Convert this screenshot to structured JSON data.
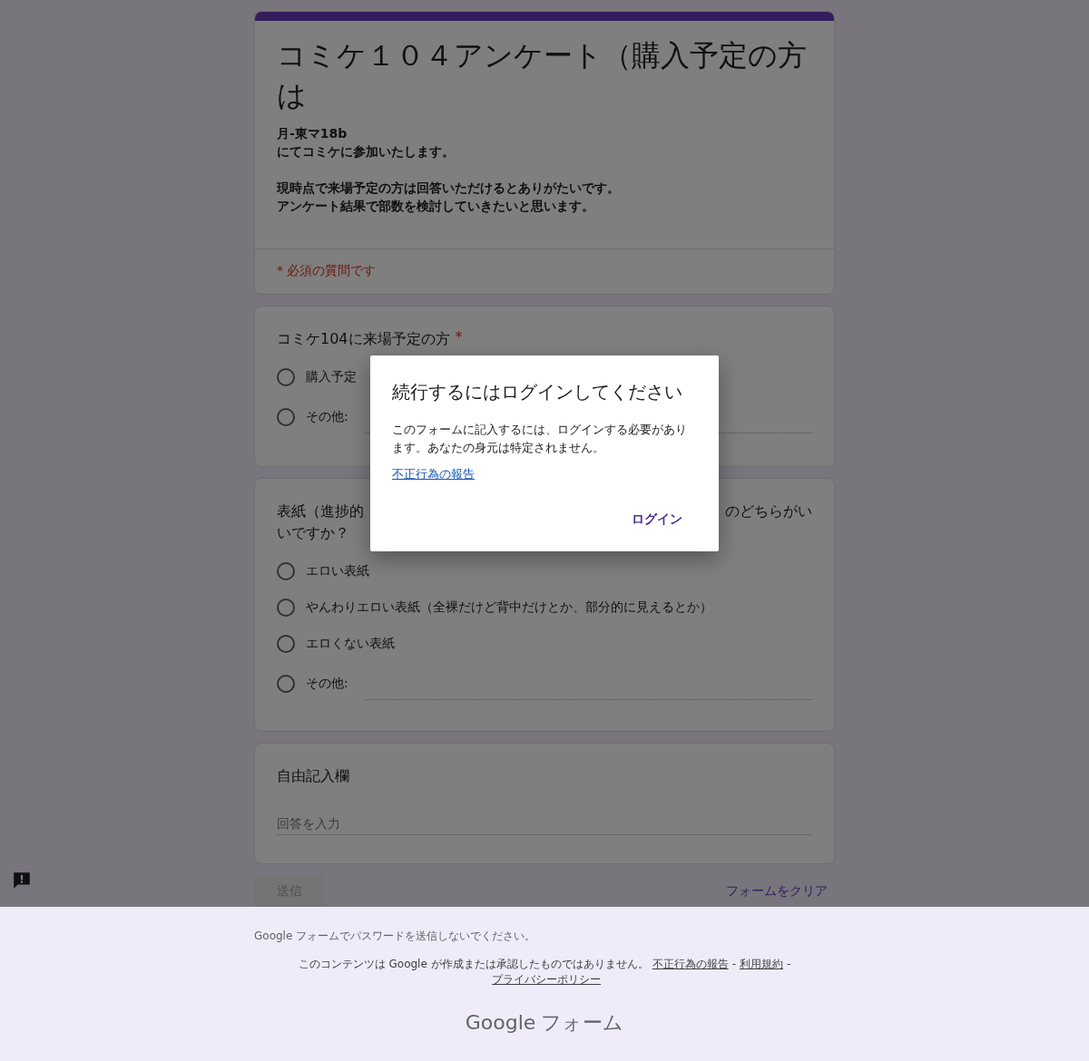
{
  "form": {
    "title": "コミケ１０４アンケート（購入予定の方は",
    "description": [
      [
        "月-東マ18b",
        "にてコミケに参加いたします。"
      ],
      [
        "現時点で来場予定の方は回答いただけるとありがたいです。",
        "アンケート結果で部数を検討していきたいと思います。"
      ]
    ],
    "required_note": "* 必須の質問です"
  },
  "questions": [
    {
      "kind": "choice",
      "title": "コミケ104に来場予定の方",
      "required_mark": "*",
      "options": [
        {
          "kind": "option",
          "label": "購入予定",
          "selected": false
        },
        {
          "kind": "other",
          "label": "その他:",
          "selected": false
        }
      ]
    },
    {
      "kind": "choice",
      "title_left": "表紙（進捗的",
      "title_right": "のどちらがい",
      "title_cont": "いですか？",
      "options": [
        {
          "kind": "option",
          "label": "エロい表紙",
          "selected": false
        },
        {
          "kind": "option",
          "label": "やんわりエロい表紙（全裸だけど背中だけとか、部分的に見えるとか）",
          "selected": false
        },
        {
          "kind": "option",
          "label": "エロくない表紙",
          "selected": false
        },
        {
          "kind": "other",
          "label": "その他:",
          "selected": false
        }
      ]
    },
    {
      "kind": "text",
      "title": "自由記入欄",
      "placeholder": "回答を入力"
    }
  ],
  "actions": {
    "submit": "送信",
    "clear": "フォームをクリア"
  },
  "dialog": {
    "title": "続行するにはログインしてください",
    "body": "このフォームに記入するには、ログインする必要があります。あなたの身元は特定されません。",
    "link": "不正行為の報告",
    "button": "ログイン"
  },
  "footer": {
    "warning": "Google フォームでパスワードを送信しないでください。",
    "disclaimer": "このコンテンツは Google が作成または承認したものではありません。",
    "links": [
      {
        "label": "不正行為の報告"
      },
      {
        "label": "利用規約"
      },
      {
        "label": "プライバシーポリシー"
      }
    ],
    "separator": "-",
    "logo_brand": "Google",
    "logo_product": "フォーム"
  }
}
